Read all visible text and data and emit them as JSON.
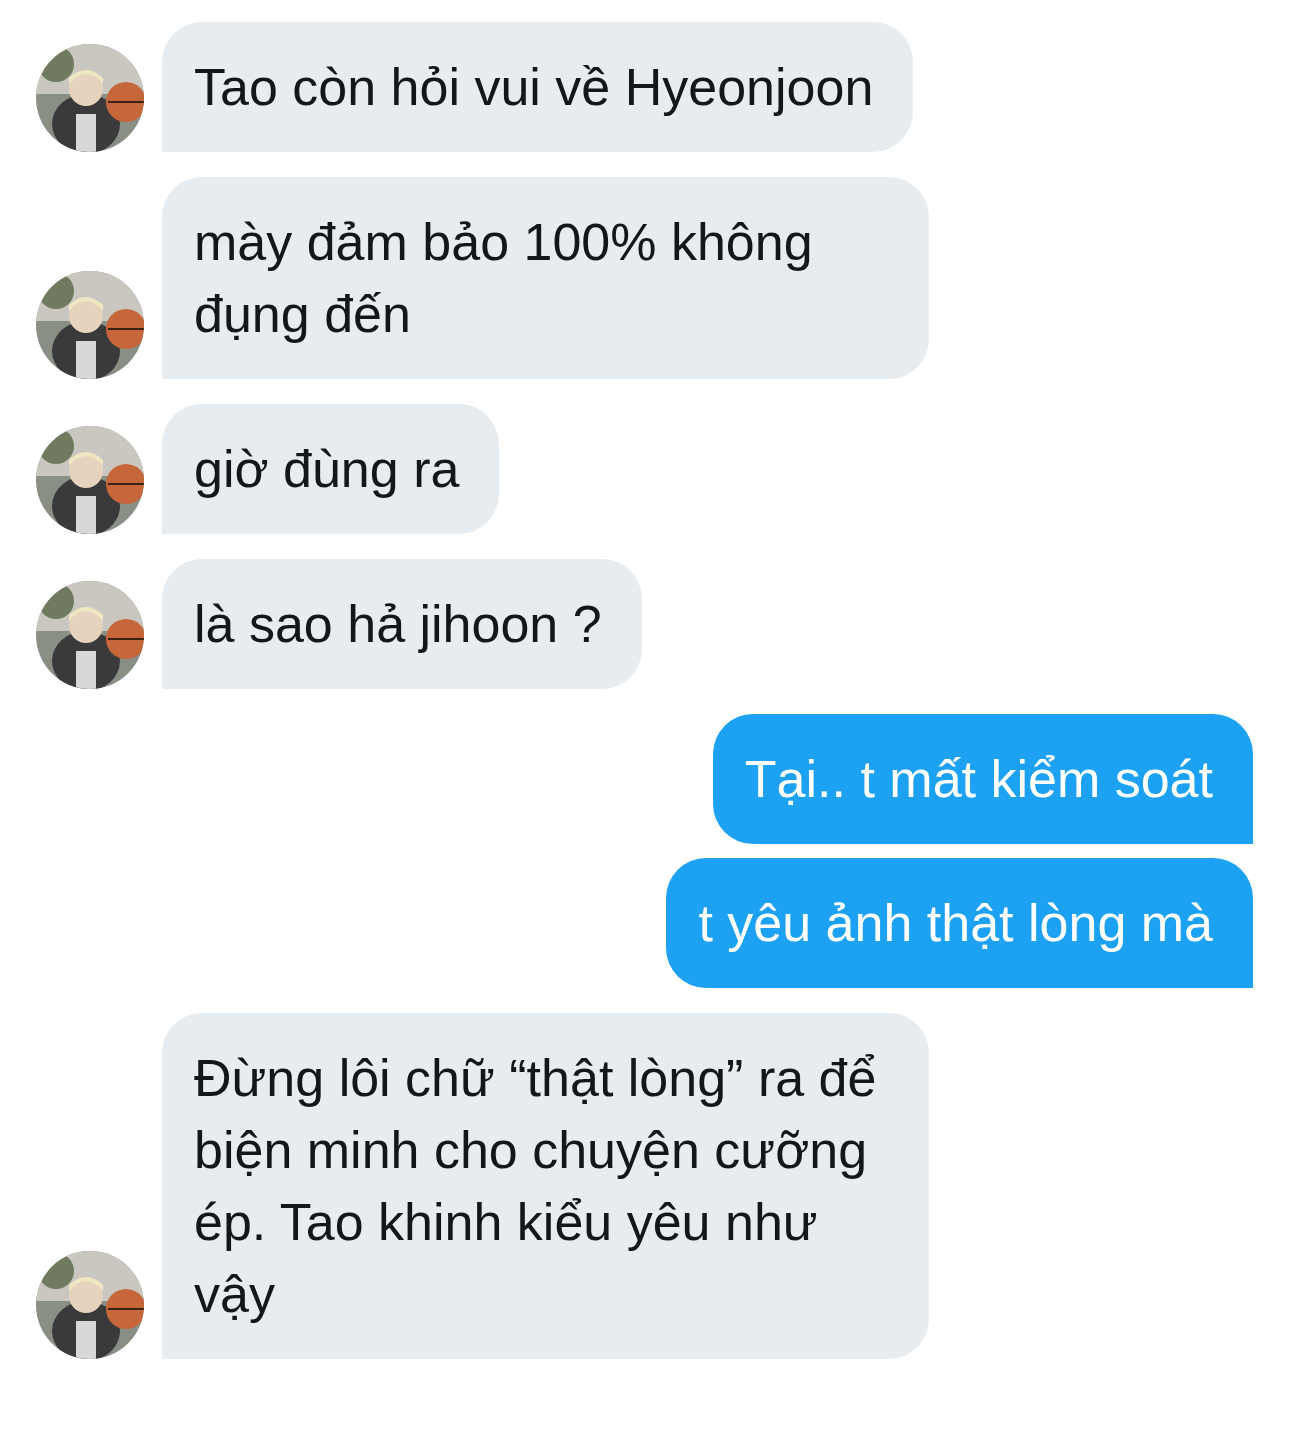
{
  "messages": [
    {
      "kind": "incoming",
      "text": "Tao còn hỏi vui về Hyeonjoon"
    },
    {
      "kind": "incoming",
      "text": "mày đảm bảo 100% không đụng đến"
    },
    {
      "kind": "incoming",
      "text": "giờ đùng ra"
    },
    {
      "kind": "incoming",
      "text": "là sao hả jihoon ?"
    },
    {
      "kind": "outgoing",
      "text": "Tại.. t mất kiểm soát"
    },
    {
      "kind": "outgoing",
      "text": "t yêu ảnh thật lòng mà"
    },
    {
      "kind": "incoming",
      "text": "Đừng lôi chữ “thật lòng” ra để biện minh cho chuyện cưỡng ép. Tao khinh kiểu yêu như vậy"
    }
  ]
}
